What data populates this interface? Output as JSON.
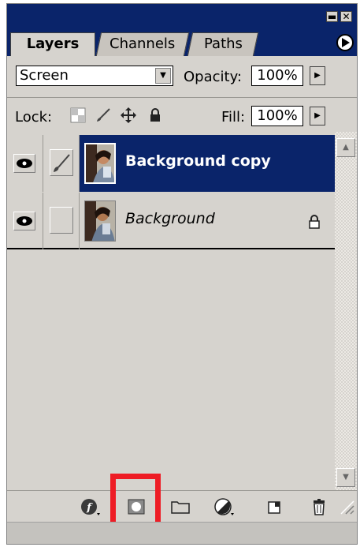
{
  "tabs": [
    "Layers",
    "Channels",
    "Paths"
  ],
  "window_buttons": {
    "minimize": "▬",
    "close": "✕"
  },
  "blend": {
    "mode": "Screen",
    "opacity_label": "Opacity:",
    "opacity_value": "100%"
  },
  "lock": {
    "label": "Lock:",
    "fill_label": "Fill:",
    "fill_value": "100%"
  },
  "layers": [
    {
      "name": "Background copy",
      "selected": true,
      "visible": true,
      "locked": false
    },
    {
      "name": "Background",
      "selected": false,
      "visible": true,
      "locked": true
    }
  ],
  "toolbar_icons": [
    "layer-style-icon",
    "add-layer-mask-icon",
    "new-group-icon",
    "adjustment-layer-icon",
    "new-layer-icon",
    "delete-layer-icon"
  ],
  "colors": {
    "titlebar": "#0a246a",
    "selection": "#0a246a",
    "panel": "#d6d3ce",
    "highlight": "#ee1c25"
  }
}
